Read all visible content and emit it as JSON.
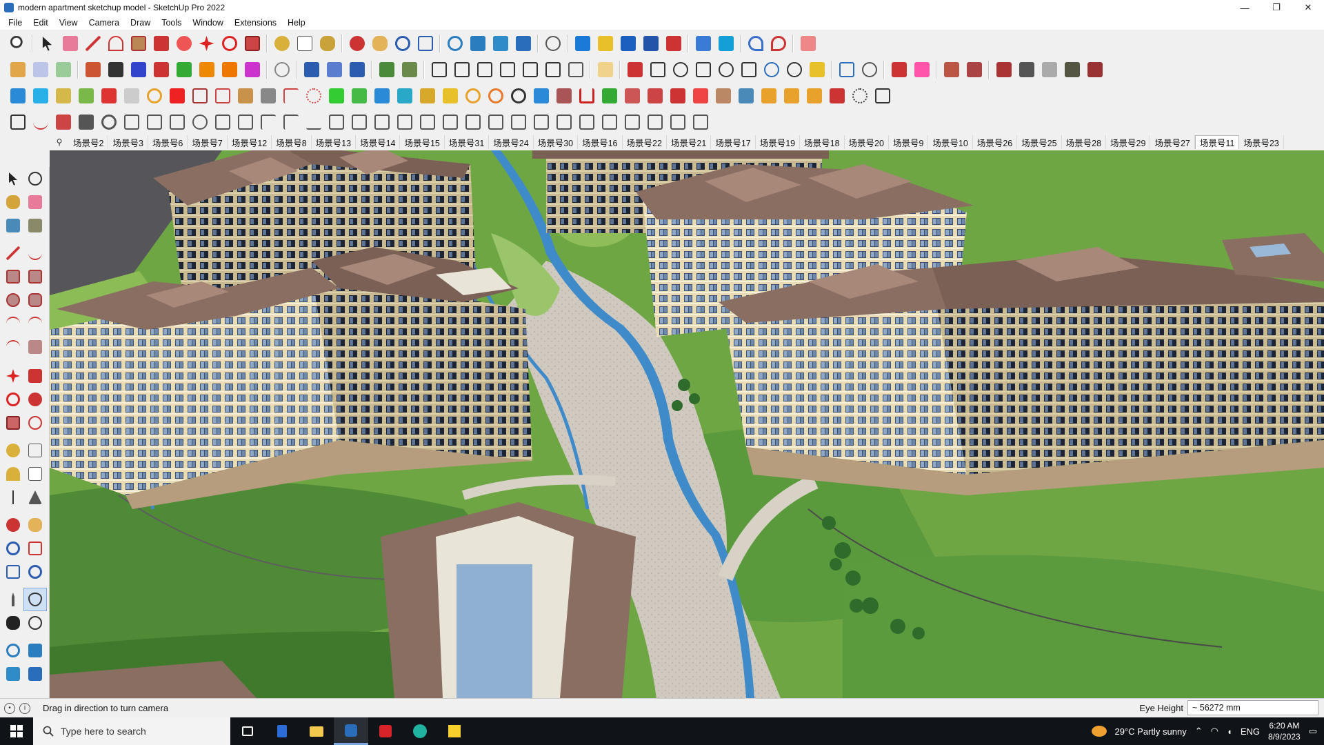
{
  "window": {
    "title": "modern apartment sketchup model - SketchUp Pro 2022",
    "controls": [
      "—",
      "❐",
      "✕"
    ]
  },
  "menu": [
    "File",
    "Edit",
    "View",
    "Camera",
    "Draw",
    "Tools",
    "Window",
    "Extensions",
    "Help"
  ],
  "scenes": {
    "search_icon": "⚲",
    "tabs": [
      "场景号2",
      "场景号3",
      "场景号6",
      "场景号7",
      "场景号12",
      "场景号8",
      "场景号13",
      "场景号14",
      "场景号15",
      "场景号31",
      "场景号24",
      "场景号30",
      "场景号16",
      "场景号22",
      "场景号21",
      "场景号17",
      "场景号19",
      "场景号18",
      "场景号20",
      "场景号9",
      "场景号10",
      "场景号26",
      "场景号25",
      "场景号28",
      "场景号29",
      "场景号27",
      "场景号11",
      "场景号23"
    ],
    "active": "场景号11"
  },
  "status": {
    "hint": "Drag in direction to turn camera",
    "measure_label": "Eye Height",
    "measure_value": "~ 56272 mm"
  },
  "taskbar": {
    "search_placeholder": "Type here to search",
    "weather": "29°C  Partly sunny",
    "language": "ENG",
    "time": "6:20 AM",
    "date": "8/9/2023"
  },
  "colors": {
    "accent": "#2a6ebb",
    "grass": "#76a94a",
    "taskbar": "#101418"
  }
}
